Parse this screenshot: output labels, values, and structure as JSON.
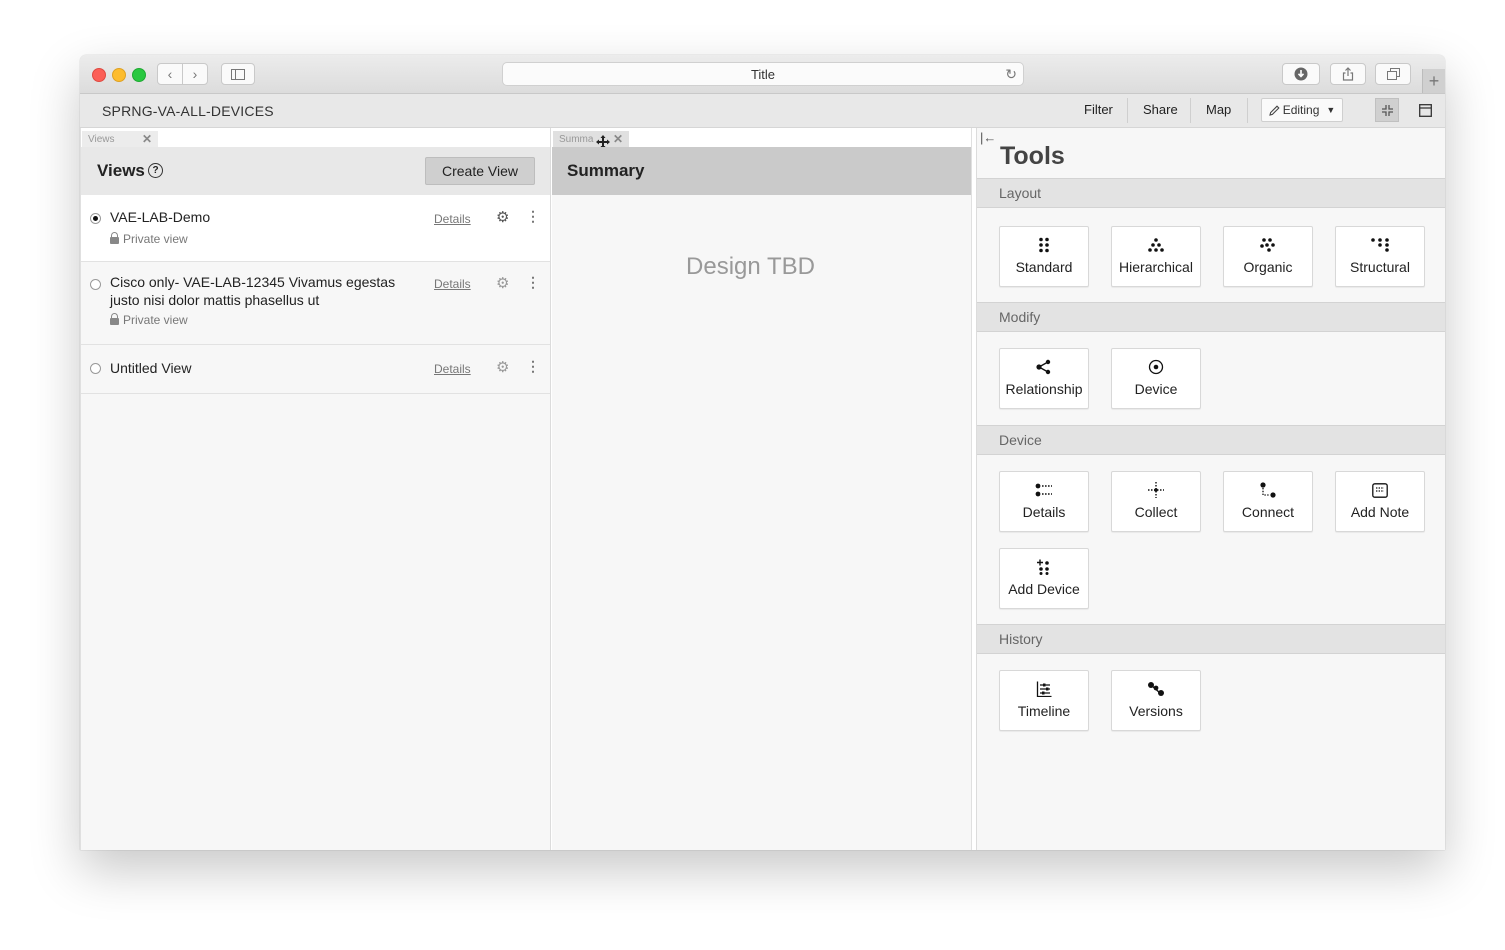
{
  "browser": {
    "address_title": "Title",
    "new_tab_label": "+"
  },
  "app": {
    "title": "SPRNG-VA-ALL-DEVICES",
    "header_links": [
      "Filter",
      "Share",
      "Map"
    ],
    "editing_label": "Editing"
  },
  "views_pane": {
    "tab_label": "Views",
    "title": "Views",
    "help_glyph": "?",
    "create_label": "Create View",
    "items": [
      {
        "name": "VAE-LAB-Demo",
        "privacy": "Private view",
        "details": "Details",
        "selected": true
      },
      {
        "name": "Cisco only- VAE-LAB-12345 Vivamus egestas justo nisi dolor mattis phasellus ut",
        "privacy": "Private view",
        "details": "Details",
        "selected": false
      },
      {
        "name": "Untitled View",
        "privacy": "",
        "details": "Details",
        "selected": false
      }
    ]
  },
  "summary_pane": {
    "tab_label": "Summa",
    "title": "Summary",
    "placeholder": "Design TBD"
  },
  "tools_pane": {
    "title": "Tools",
    "sections": [
      {
        "name": "Layout",
        "tools": [
          "Standard",
          "Hierarchical",
          "Organic",
          "Structural"
        ]
      },
      {
        "name": "Modify",
        "tools": [
          "Relationship",
          "Device"
        ]
      },
      {
        "name": "Device",
        "tools": [
          "Details",
          "Collect",
          "Connect",
          "Add Note",
          "Add Device"
        ]
      },
      {
        "name": "History",
        "tools": [
          "Timeline",
          "Versions"
        ]
      }
    ]
  },
  "icons": {
    "back": "chevron-left-icon",
    "forward": "chevron-right-icon",
    "sidebar": "sidebar-icon",
    "reload": "reload-icon",
    "download": "download-icon",
    "share": "share-icon",
    "tabs": "tabs-icon",
    "pencil": "pencil-icon",
    "collapse": "collapse-icon",
    "panel": "panel-icon"
  },
  "colors": {
    "header_bg": "#e8e8e8",
    "summary_header_bg": "#cacaca",
    "section_bg": "#e3e3e3"
  }
}
